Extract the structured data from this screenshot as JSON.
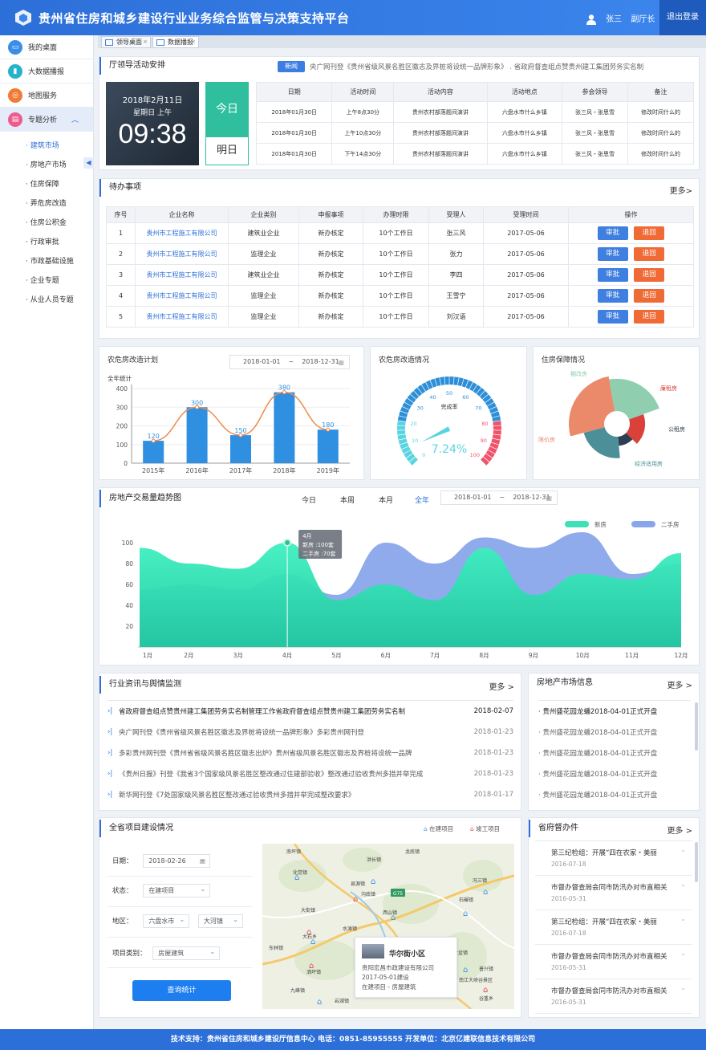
{
  "app": {
    "title": "贵州省住房和城乡建设行业业务综合监管与决策支持平台",
    "user": "张三",
    "role": "副厅长",
    "logout": "退出登录"
  },
  "sidebar": {
    "items": [
      {
        "label": "我的桌面",
        "color": "#3a8ee6"
      },
      {
        "label": "大数据播报",
        "color": "#26b3c9"
      },
      {
        "label": "地图服务",
        "color": "#f07a36"
      },
      {
        "label": "专题分析",
        "color": "#ef5b8d"
      }
    ],
    "sub": [
      "建筑市场",
      "房地产市场",
      "住房保障",
      "弄危房改造",
      "住房公积金",
      "行政审批",
      "市政基础设施",
      "企业专题",
      "从业人员专题"
    ]
  },
  "tabs": [
    "领导桌面",
    "数据播报"
  ],
  "schedule": {
    "title": "厅领导活动安排",
    "badge": "新闻",
    "ticker": "央广网刊登《贵州省级风景名胜区徽志及界桩将设统一品牌形象》  .  省政府督查组点赞贵州建工集团劳务实名制",
    "date": "2018年2月11日",
    "weekday": "星期日 上午",
    "time": "09:38",
    "today": "今日",
    "tomorrow": "明日",
    "headers": [
      "日期",
      "活动时间",
      "活动内容",
      "活动地点",
      "参会领导",
      "备注"
    ],
    "rows": [
      [
        "2018年01月30日",
        "上午8点30分",
        "贵州农村部落题间演讲",
        "六盘水市什么乡镇",
        "张三风・张思雪",
        "修改时间什么的"
      ],
      [
        "2018年01月30日",
        "上午10点30分",
        "贵州农村部落题间演讲",
        "六盘水市什么乡镇",
        "张三风・张思雪",
        "修改时间什么的"
      ],
      [
        "2018年01月30日",
        "下午14点30分",
        "贵州农村部落题间演讲",
        "六盘水市什么乡镇",
        "张三风・张思雪",
        "修改时间什么的"
      ]
    ]
  },
  "todo": {
    "title": "待办事项",
    "more": "更多>",
    "headers": [
      "序号",
      "企业名称",
      "企业类别",
      "申报事项",
      "办理时限",
      "受理人",
      "受理时间",
      "操作"
    ],
    "approve": "审批",
    "reject": "退回",
    "rows": [
      [
        "1",
        "贵州市工程施工有限公司",
        "建筑业企业",
        "新办核定",
        "10个工作日",
        "张三风",
        "2017-05-06"
      ],
      [
        "2",
        "贵州市工程施工有限公司",
        "监理企业",
        "新办核定",
        "10个工作日",
        "张力",
        "2017-05-06"
      ],
      [
        "3",
        "贵州市工程施工有限公司",
        "建筑业企业",
        "新办核定",
        "10个工作日",
        "李四",
        "2017-05-06"
      ],
      [
        "4",
        "贵州市工程施工有限公司",
        "监理企业",
        "新办核定",
        "10个工作日",
        "王雪宁",
        "2017-05-06"
      ],
      [
        "5",
        "贵州市工程施工有限公司",
        "监理企业",
        "新办核定",
        "10个工作日",
        "刘汉语",
        "2017-05-06"
      ]
    ]
  },
  "charts": {
    "plan": {
      "title": "农危房改造计划",
      "date_from": "2018-01-01",
      "date_to": "2018-12-31",
      "tilde": "~",
      "ylabel": "全年统计"
    },
    "gauge": {
      "title": "农危房改造情况",
      "label": "完成率",
      "value": "7.24%"
    },
    "housing": {
      "title": "住房保障情况"
    },
    "trend": {
      "title": "房地产交易量趋势图",
      "filters": [
        "今日",
        "本周",
        "本月",
        "全年"
      ],
      "date_from": "2018-01-01",
      "date_to": "2018-12-31",
      "tooltip": [
        "4月",
        "新房 :100套",
        "二手房 :70套"
      ]
    }
  },
  "chart_data": [
    {
      "type": "bar",
      "title": "农危房改造计划",
      "ylabel": "全年统计",
      "categories": [
        "2015年",
        "2016年",
        "2017年",
        "2018年",
        "2019年"
      ],
      "values": [
        120,
        300,
        150,
        380,
        180
      ],
      "ylim": [
        0,
        400
      ],
      "yticks": [
        0,
        100,
        200,
        300,
        400
      ],
      "colors": [
        "#2f8fe0",
        "#f08a50"
      ]
    },
    {
      "type": "gauge",
      "title": "农危房改造情况",
      "label": "完成率",
      "value": 7.24,
      "range": [
        0,
        100
      ],
      "ticks": [
        0,
        10,
        20,
        30,
        40,
        50,
        60,
        70,
        80,
        90,
        100
      ]
    },
    {
      "type": "pie",
      "title": "住房保障情况",
      "series": [
        {
          "name": "棚改房",
          "value": 42,
          "color": "#8fcfb0"
        },
        {
          "name": "廉租房",
          "value": 20,
          "color": "#d9413a"
        },
        {
          "name": "公租房",
          "value": 12,
          "color": "#2c3e50"
        },
        {
          "name": "经济适用房",
          "value": 28,
          "color": "#4d8f99"
        },
        {
          "name": "限价房",
          "value": 46,
          "color": "#ea8a6b"
        }
      ]
    },
    {
      "type": "area",
      "title": "房地产交易量趋势图",
      "x": [
        "1月",
        "2月",
        "3月",
        "4月",
        "5月",
        "6月",
        "7月",
        "8月",
        "9月",
        "10月",
        "11月",
        "12月"
      ],
      "ylim": [
        0,
        100
      ],
      "yticks": [
        0,
        20,
        40,
        60,
        80,
        100
      ],
      "series": [
        {
          "name": "新房",
          "values": [
            95,
            80,
            75,
            100,
            45,
            60,
            45,
            95,
            50,
            70,
            65,
            90
          ],
          "color": "#3ee0b8"
        },
        {
          "name": "二手房",
          "values": [
            55,
            60,
            55,
            70,
            50,
            100,
            80,
            105,
            95,
            110,
            70,
            80
          ],
          "color": "#8aa6ea"
        }
      ]
    }
  ],
  "news": {
    "title": "行业资讯与舆情监测",
    "more": "更多 >",
    "items": [
      [
        "省政府督查组点赞贵州建工集团劳务实名制管理工作省政府督查组点赞贵州建工集团劳务实名制",
        "2018-02-07"
      ],
      [
        "央广网刊登《贵州省级风景名胜区徽志及界桩将设统一品牌形象》多彩贵州网刊登",
        "2018-01-23"
      ],
      [
        "多彩贵州网刊登《贵州省省级风景名胜区徽志出炉》贵州省级风景名胜区徽志及界桩将设统一品牌",
        "2018-01-23"
      ],
      [
        "《贵州日报》刊登《我省3个国家级风景名胜区整改通过住建部验收》整改通过验收贵州多措并举完成",
        "2018-01-23"
      ],
      [
        "新华网刊登《7处国家级风景名胜区整改通过验收贵州多措并举完成整改要求》",
        "2018-01-17"
      ]
    ]
  },
  "market": {
    "title": "房地产市场信息",
    "more": "更多 >",
    "items": [
      "贵州盛花园龙蟠2018-04-01正式开盘",
      "贵州盛花园龙蟠2018-04-01正式开盘",
      "贵州盛花园龙蟠2018-04-01正式开盘",
      "贵州盛花园龙蟠2018-04-01正式开盘",
      "贵州盛花园龙蟠2018-04-01正式开盘"
    ]
  },
  "projects": {
    "title": "全省项目建设情况",
    "legend_a": "在建项目",
    "legend_b": "竣工项目",
    "date_label": "日期：",
    "date": "2018-02-26",
    "status_label": "状态：",
    "status": "在建项目",
    "region_label": "地区：",
    "region_a": "六盘水市",
    "region_b": "大河镇",
    "type_label": "项目类别：",
    "type": "房屋建筑",
    "button": "查询统计",
    "popup": {
      "name": "华尔街小区",
      "company": "贵阳宏昌市政建设有限公司",
      "date": "2017-05-01建设",
      "status": "在建项目 - 房屋建筑"
    },
    "places": [
      "南坪镇",
      "化觉镇",
      "洪长镇",
      "龙底镇",
      "县源镇",
      "沟底镇",
      "冯三镇",
      "大街镇",
      "西山镇",
      "石碾镇",
      "水滩镇",
      "大石乡",
      "东林镇",
      "洒坪镇",
      "金盆镇",
      "南江大峡谷景区",
      "普兴镇",
      "谷重乡",
      "岩湖镇",
      "九峰镇"
    ],
    "road": "G75"
  },
  "office": {
    "title": "省府督办件",
    "more": "更多 >",
    "items": [
      [
        "第三纪检组：开展“四在农家・美丽",
        "2016-07-18"
      ],
      [
        "市督办督查局会同市防汛办对市直相关",
        "2016-05-31"
      ],
      [
        "第三纪检组：开展“四在农家・美丽",
        "2016-07-18"
      ],
      [
        "市督办督查局会同市防汛办对市直相关",
        "2016-05-31"
      ],
      [
        "市督办督查局会同市防汛办对市直相关",
        "2016-05-31"
      ]
    ]
  },
  "footer": "技术支持：贵州省住房和城乡建设厅信息中心  电话：0851-85955555  开发单位：北京亿建联信息技术有限公司"
}
